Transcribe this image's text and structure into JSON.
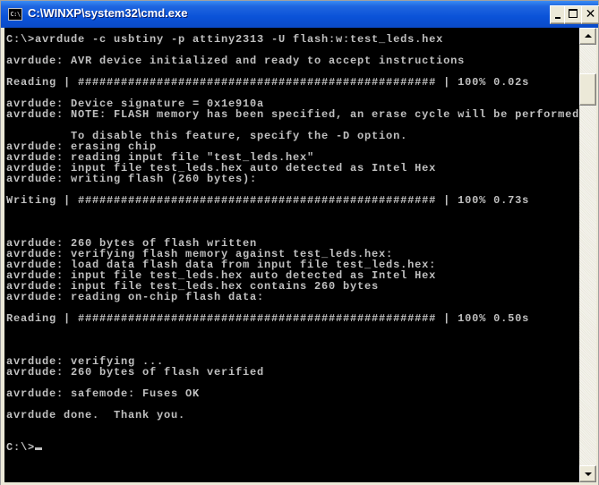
{
  "window": {
    "title": "C:\\WINXP\\system32\\cmd.exe",
    "icon": "console-icon",
    "icon_text": "C:\\",
    "controls": {
      "minimize": "minimize-icon",
      "maximize": "maximize-icon",
      "close_label": "✕"
    }
  },
  "console": {
    "foreground_color": "#c0c0c0",
    "background_color": "#000000",
    "lines": [
      "C:\\>avrdude -c usbtiny -p attiny2313 -U flash:w:test_leds.hex",
      "",
      "avrdude: AVR device initialized and ready to accept instructions",
      "",
      "Reading | ################################################## | 100% 0.02s",
      "",
      "avrdude: Device signature = 0x1e910a",
      "avrdude: NOTE: FLASH memory has been specified, an erase cycle will be performed",
      "",
      "         To disable this feature, specify the -D option.",
      "avrdude: erasing chip",
      "avrdude: reading input file \"test_leds.hex\"",
      "avrdude: input file test_leds.hex auto detected as Intel Hex",
      "avrdude: writing flash (260 bytes):",
      "",
      "Writing | ################################################## | 100% 0.73s",
      "",
      "",
      "",
      "avrdude: 260 bytes of flash written",
      "avrdude: verifying flash memory against test_leds.hex:",
      "avrdude: load data flash data from input file test_leds.hex:",
      "avrdude: input file test_leds.hex auto detected as Intel Hex",
      "avrdude: input file test_leds.hex contains 260 bytes",
      "avrdude: reading on-chip flash data:",
      "",
      "Reading | ################################################## | 100% 0.50s",
      "",
      "",
      "",
      "avrdude: verifying ...",
      "avrdude: 260 bytes of flash verified",
      "",
      "avrdude: safemode: Fuses OK",
      "",
      "avrdude done.  Thank you.",
      "",
      "",
      "C:\\>"
    ],
    "progress": [
      {
        "label": "Reading",
        "percent": 100,
        "time": "0.02s"
      },
      {
        "label": "Writing",
        "percent": 100,
        "time": "0.73s"
      },
      {
        "label": "Reading",
        "percent": 100,
        "time": "0.50s"
      }
    ]
  },
  "scrollbar": {
    "position_fraction": 0.08
  }
}
